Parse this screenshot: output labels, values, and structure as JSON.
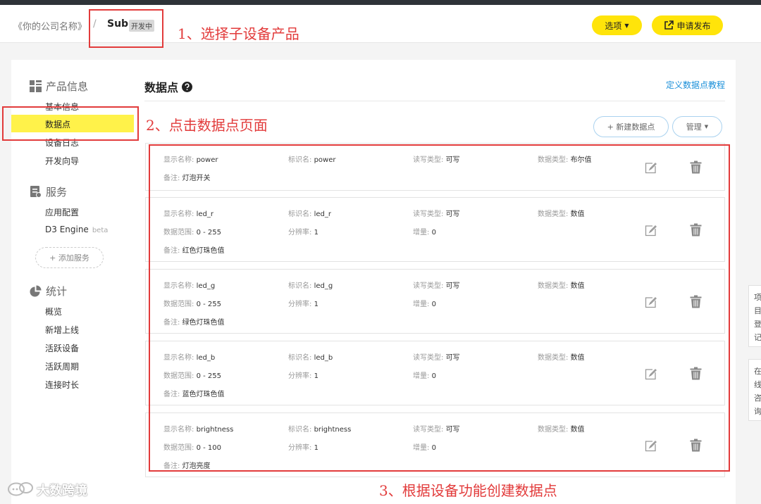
{
  "header": {
    "company": "《你的公司名称》",
    "separator": "/",
    "product": "Sub",
    "status_badge": "开发中",
    "options_label": "选项",
    "publish_label": "申请发布"
  },
  "sidebar": {
    "product_info_title": "产品信息",
    "items_product": [
      "基本信息",
      "数据点",
      "设备日志",
      "开发向导"
    ],
    "service_title": "服务",
    "items_service": [
      "应用配置",
      "D3 Engine"
    ],
    "beta_label": "beta",
    "add_service_label": "+ 添加服务",
    "stats_title": "统计",
    "items_stats": [
      "概览",
      "新增上线",
      "活跃设备",
      "活跃周期",
      "连接时长"
    ]
  },
  "main": {
    "title": "数据点",
    "tutorial_link": "定义数据点教程",
    "new_button": "+ 新建数据点",
    "manage_button": "管理",
    "labels": {
      "display_name": "显示名称:",
      "identifier": "标识名:",
      "rw_type": "读写类型:",
      "data_type": "数据类型:",
      "range": "数据范围:",
      "resolution": "分辨率:",
      "increment": "增量:",
      "note": "备注:"
    },
    "datapoints": [
      {
        "display_name": "power",
        "identifier": "power",
        "rw_type": "可写",
        "data_type": "布尔值",
        "note": "灯泡开关"
      },
      {
        "display_name": "led_r",
        "identifier": "led_r",
        "rw_type": "可写",
        "data_type": "数值",
        "range": "0 - 255",
        "resolution": "1",
        "increment": "0",
        "note": "红色灯珠色值"
      },
      {
        "display_name": "led_g",
        "identifier": "led_g",
        "rw_type": "可写",
        "data_type": "数值",
        "range": "0 - 255",
        "resolution": "1",
        "increment": "0",
        "note": "绿色灯珠色值"
      },
      {
        "display_name": "led_b",
        "identifier": "led_b",
        "rw_type": "可写",
        "data_type": "数值",
        "range": "0 - 255",
        "resolution": "1",
        "increment": "0",
        "note": "蓝色灯珠色值"
      },
      {
        "display_name": "brightness",
        "identifier": "brightness",
        "rw_type": "可写",
        "data_type": "数值",
        "range": "0 - 100",
        "resolution": "1",
        "increment": "0",
        "note": "灯泡亮度"
      }
    ]
  },
  "right_tabs": [
    {
      "chars": [
        "项",
        "目",
        "登",
        "记"
      ]
    },
    {
      "chars": [
        "在",
        "线",
        "咨",
        "询"
      ]
    }
  ],
  "annotations": {
    "step1": "1、选择子设备产品",
    "step2": "2、点击数据点页面",
    "step3": "3、根据设备功能创建数据点"
  },
  "watermark": "大数跨境",
  "colors": {
    "accent_yellow": "#ffe40a",
    "annotation_red": "#e23b3b",
    "link_blue": "#1a8fd9",
    "topbar_dark": "#2e3338"
  }
}
